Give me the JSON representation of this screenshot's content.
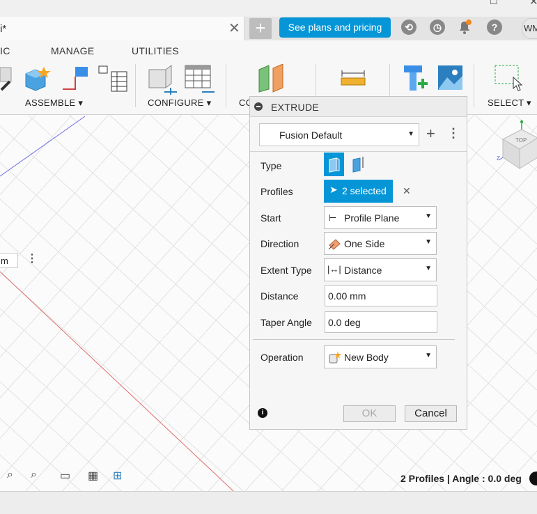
{
  "document_tab": {
    "title": "i*",
    "close_glyph": "✕"
  },
  "top_bar": {
    "plans_button": "See plans and pricing",
    "avatar_initials": "WM",
    "new_tab_glyph": "+"
  },
  "ribbon": {
    "tabs": [
      "IC",
      "MANAGE",
      "UTILITIES"
    ],
    "groups": {
      "assemble": "ASSEMBLE ▾",
      "configure": "CONFIGURE ▾",
      "construct_partial": "CO",
      "select": "SELECT ▾"
    }
  },
  "dialog": {
    "title": "EXTRUDE",
    "preset": "Fusion Default",
    "rows": {
      "type_label": "Type",
      "profiles_label": "Profiles",
      "profiles_value": "2 selected",
      "start_label": "Start",
      "start_value": "Profile Plane",
      "direction_label": "Direction",
      "direction_value": "One Side",
      "extent_label": "Extent Type",
      "extent_value": "Distance",
      "distance_label": "Distance",
      "distance_value": "0.00 mm",
      "taper_label": "Taper Angle",
      "taper_value": "0.0 deg",
      "operation_label": "Operation",
      "operation_value": "New Body"
    },
    "ok": "OK",
    "cancel": "Cancel"
  },
  "viewport": {
    "left_field_fragment": "m",
    "viewcube_label": "TOP"
  },
  "status_text": "2 Profiles | Angle : 0.0 deg",
  "colors": {
    "accent": "#0696d7",
    "annotation": "#22c022",
    "x_axis": "#e05050",
    "y_axis": "#5050e0"
  }
}
